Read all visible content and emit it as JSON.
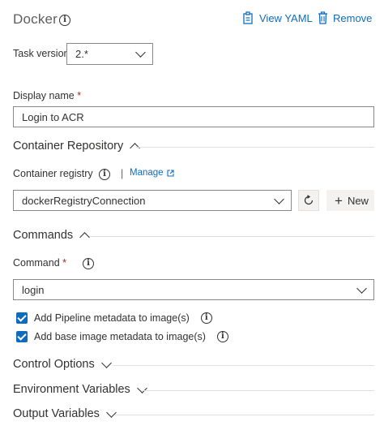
{
  "header": {
    "title": "Docker",
    "view_yaml": "View YAML",
    "remove": "Remove"
  },
  "task_version": {
    "label": "Task version",
    "value": "2.*"
  },
  "display_name": {
    "label": "Display name",
    "required_mark": "*",
    "value": "Login to ACR"
  },
  "container_repository": {
    "heading": "Container Repository",
    "registry_label": "Container registry",
    "separator": "|",
    "manage_label": "Manage",
    "registry_value": "dockerRegistryConnection",
    "new_label": "New"
  },
  "commands": {
    "heading": "Commands",
    "command_label": "Command",
    "required_mark": "*",
    "command_value": "login",
    "checkboxes": [
      {
        "label": "Add Pipeline metadata to image(s)",
        "checked": true
      },
      {
        "label": "Add base image metadata to image(s)",
        "checked": true
      }
    ]
  },
  "sections": {
    "control_options": "Control Options",
    "environment_variables": "Environment Variables",
    "output_variables": "Output Variables"
  },
  "colors": {
    "accent": "#0f6cbd",
    "required": "#a4262c"
  }
}
